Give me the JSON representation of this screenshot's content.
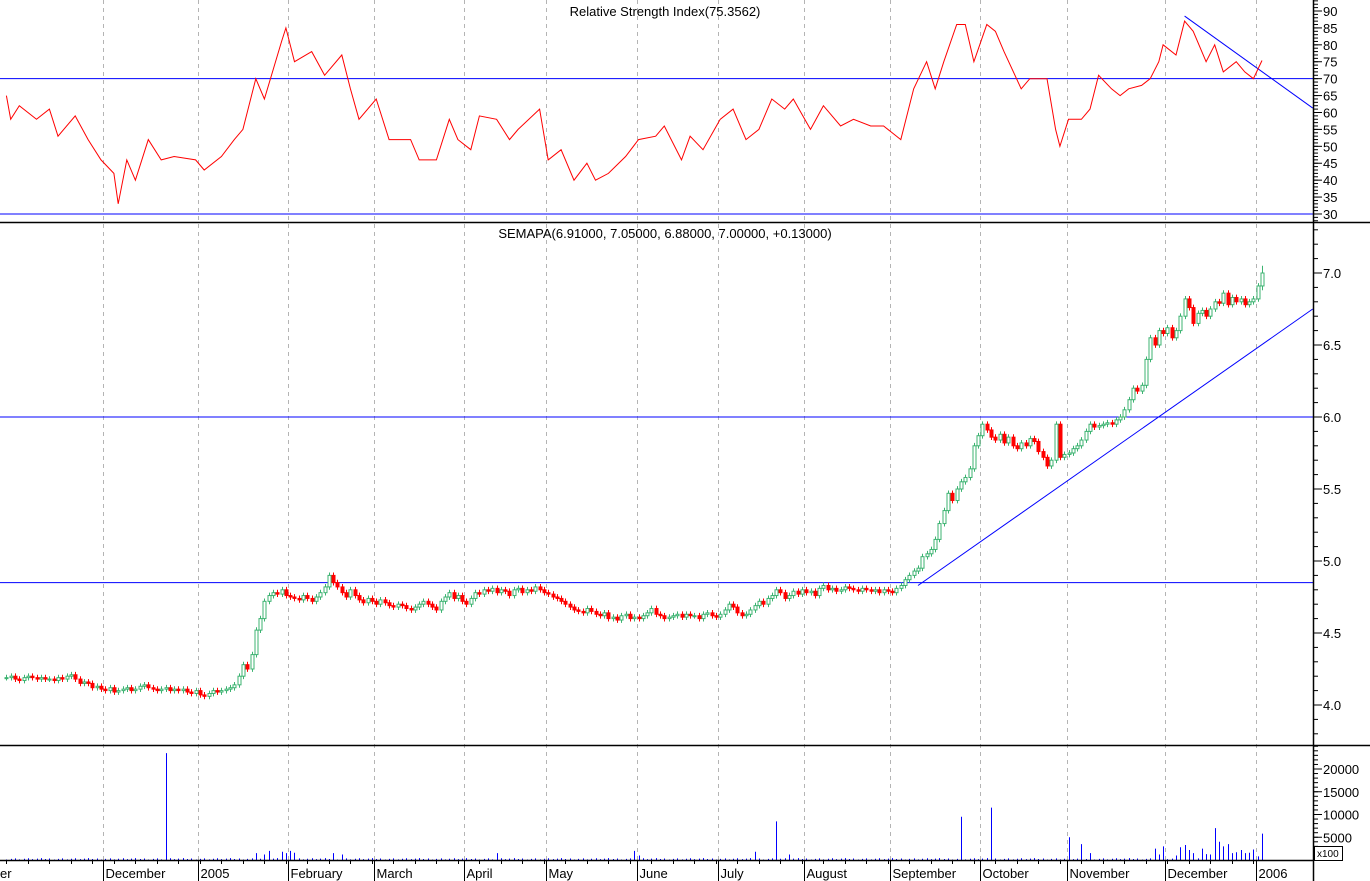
{
  "chart_data": [
    {
      "type": "line",
      "title": "Relative Strength Index(75.3562)",
      "indicator": "RSI",
      "ylim": [
        27.6,
        93.2
      ],
      "yticks": [
        30,
        35,
        40,
        45,
        50,
        55,
        60,
        65,
        70,
        75,
        80,
        85,
        90
      ],
      "reference_lines": [
        70,
        30
      ],
      "trendline": {
        "from": {
          "bar": 274,
          "value": 88.5
        },
        "to": {
          "bar": 303.8,
          "value": 61.3
        }
      },
      "series": {
        "bars": [
          0,
          1,
          3,
          7,
          10,
          12,
          16,
          19,
          22,
          25,
          26,
          28,
          30,
          33,
          36,
          39,
          44,
          46,
          50,
          53,
          55,
          58,
          60,
          64,
          65,
          67,
          71,
          74,
          78,
          80,
          82,
          86,
          89,
          94,
          96,
          100,
          103,
          105,
          108,
          110,
          114,
          117,
          119,
          124,
          126,
          129,
          132,
          135,
          137,
          140,
          144,
          147,
          151,
          153,
          157,
          159,
          162,
          166,
          169,
          172,
          175,
          178,
          181,
          183,
          187,
          190,
          194,
          197,
          201,
          204,
          208,
          211,
          214,
          216,
          218,
          221,
          223,
          225,
          228,
          230,
          232,
          236,
          238,
          242,
          244,
          245,
          247,
          250,
          252,
          254,
          257,
          259,
          261,
          264,
          266,
          268,
          269,
          272,
          274,
          276,
          279,
          281,
          283,
          286,
          288,
          290,
          292
        ],
        "values": [
          65,
          58,
          62,
          58,
          61,
          53,
          59,
          52,
          46,
          42,
          33,
          46,
          40,
          52,
          46,
          47,
          46,
          43,
          47,
          52,
          55,
          70,
          64,
          81,
          85,
          75,
          78,
          71,
          77,
          67,
          58,
          64,
          52,
          52,
          46,
          46,
          58,
          52,
          49,
          59,
          58,
          52,
          55,
          61,
          46,
          49,
          40,
          45,
          40,
          42,
          47,
          52,
          53,
          56,
          46,
          53,
          49,
          58,
          61,
          52,
          55,
          64,
          61,
          64,
          55,
          62,
          56,
          58,
          56,
          56,
          52,
          67,
          75,
          67,
          75,
          86,
          86,
          75,
          86,
          84,
          78,
          67,
          70,
          70,
          55,
          50,
          58,
          58,
          61,
          71,
          67,
          65,
          67,
          68,
          70,
          75,
          80,
          77,
          87,
          84,
          75,
          80,
          72,
          75,
          72,
          70,
          75.36
        ]
      }
    },
    {
      "type": "candlestick",
      "title": "SEMAPA(6.91000, 7.05000, 6.88000, 7.00000, +0.13000)",
      "ylim": [
        3.73,
        7.35
      ],
      "yticks": [
        "4.0",
        "4.5",
        "5.0",
        "5.5",
        "6.0",
        "6.5",
        "7.0"
      ],
      "colors": {
        "up": "#3cb371",
        "down": "#ff0000",
        "lines": "#0000ff"
      },
      "reference_lines": [
        6.0,
        4.85
      ],
      "trendline": {
        "from": {
          "bar": 212,
          "value": 4.83
        },
        "to": {
          "bar": 303.8,
          "value": 6.75
        }
      },
      "last_bar": {
        "open": 6.91,
        "high": 7.05,
        "low": 6.88,
        "close": 7.0,
        "change": 0.13
      },
      "close": [
        4.19,
        4.2,
        4.18,
        4.17,
        4.19,
        4.2,
        4.19,
        4.18,
        4.19,
        4.18,
        4.18,
        4.17,
        4.19,
        4.18,
        4.2,
        4.21,
        4.18,
        4.15,
        4.16,
        4.15,
        4.12,
        4.13,
        4.11,
        4.1,
        4.12,
        4.09,
        4.1,
        4.11,
        4.12,
        4.1,
        4.11,
        4.13,
        4.14,
        4.12,
        4.11,
        4.1,
        4.11,
        4.12,
        4.1,
        4.11,
        4.1,
        4.11,
        4.09,
        4.08,
        4.1,
        4.07,
        4.06,
        4.08,
        4.1,
        4.09,
        4.1,
        4.11,
        4.12,
        4.14,
        4.2,
        4.28,
        4.25,
        4.35,
        4.52,
        4.6,
        4.72,
        4.76,
        4.78,
        4.77,
        4.8,
        4.76,
        4.75,
        4.74,
        4.73,
        4.76,
        4.74,
        4.72,
        4.75,
        4.78,
        4.82,
        4.9,
        4.85,
        4.82,
        4.78,
        4.75,
        4.8,
        4.76,
        4.73,
        4.71,
        4.74,
        4.72,
        4.7,
        4.73,
        4.71,
        4.69,
        4.68,
        4.7,
        4.69,
        4.67,
        4.66,
        4.68,
        4.7,
        4.72,
        4.7,
        4.68,
        4.66,
        4.72,
        4.75,
        4.78,
        4.74,
        4.76,
        4.72,
        4.7,
        4.74,
        4.78,
        4.77,
        4.8,
        4.79,
        4.81,
        4.78,
        4.8,
        4.79,
        4.76,
        4.8,
        4.81,
        4.78,
        4.8,
        4.79,
        4.82,
        4.8,
        4.78,
        4.77,
        4.75,
        4.74,
        4.72,
        4.7,
        4.68,
        4.66,
        4.65,
        4.64,
        4.67,
        4.65,
        4.63,
        4.62,
        4.64,
        4.6,
        4.61,
        4.59,
        4.62,
        4.63,
        4.6,
        4.61,
        4.6,
        4.62,
        4.64,
        4.67,
        4.63,
        4.62,
        4.6,
        4.61,
        4.62,
        4.63,
        4.61,
        4.63,
        4.62,
        4.62,
        4.6,
        4.63,
        4.64,
        4.62,
        4.61,
        4.63,
        4.66,
        4.7,
        4.68,
        4.64,
        4.62,
        4.63,
        4.66,
        4.69,
        4.72,
        4.7,
        4.74,
        4.76,
        4.8,
        4.78,
        4.74,
        4.76,
        4.79,
        4.77,
        4.8,
        4.78,
        4.79,
        4.76,
        4.81,
        4.83,
        4.8,
        4.81,
        4.79,
        4.8,
        4.82,
        4.81,
        4.8,
        4.79,
        4.81,
        4.8,
        4.79,
        4.8,
        4.78,
        4.8,
        4.79,
        4.78,
        4.81,
        4.83,
        4.87,
        4.9,
        4.93,
        4.95,
        5.03,
        5.05,
        5.08,
        5.15,
        5.26,
        5.35,
        5.47,
        5.42,
        5.5,
        5.55,
        5.58,
        5.64,
        5.8,
        5.87,
        5.95,
        5.91,
        5.86,
        5.84,
        5.88,
        5.82,
        5.86,
        5.8,
        5.78,
        5.82,
        5.8,
        5.85,
        5.83,
        5.76,
        5.72,
        5.66,
        5.7,
        5.95,
        5.72,
        5.74,
        5.75,
        5.78,
        5.8,
        5.84,
        5.9,
        5.95,
        5.93,
        5.94,
        5.95,
        5.96,
        5.95,
        5.98,
        6.0,
        6.05,
        6.12,
        6.2,
        6.18,
        6.22,
        6.4,
        6.55,
        6.5,
        6.6,
        6.58,
        6.62,
        6.55,
        6.6,
        6.7,
        6.82,
        6.76,
        6.65,
        6.72,
        6.74,
        6.7,
        6.75,
        6.8,
        6.79,
        6.86,
        6.78,
        6.83,
        6.8,
        6.82,
        6.78,
        6.8,
        6.82,
        6.91,
        7.0
      ]
    },
    {
      "type": "bar",
      "title": "Volume",
      "unit_label": "x100",
      "ylim": [
        0,
        25270
      ],
      "yticks": [
        "5000",
        "10000",
        "15000",
        "20000"
      ],
      "default_value": 300,
      "bars": [
        37,
        58,
        60,
        61,
        64,
        65,
        66,
        67,
        76,
        78,
        114,
        146,
        147,
        174,
        179,
        182,
        222,
        229,
        247,
        250,
        252,
        267,
        268,
        269,
        272,
        273,
        274,
        275,
        276,
        278,
        279,
        280,
        281,
        282,
        283,
        284,
        285,
        286,
        287,
        288,
        289,
        290,
        291,
        292
      ],
      "values": [
        23500,
        1500,
        1200,
        2000,
        1800,
        1500,
        2000,
        1600,
        1500,
        1200,
        1500,
        2000,
        1000,
        1800,
        8500,
        1200,
        9500,
        11500,
        5000,
        3500,
        1500,
        2500,
        1200,
        3000,
        1000,
        2800,
        3300,
        2200,
        1500,
        2500,
        1300,
        1200,
        7000,
        4000,
        3000,
        3500,
        1500,
        1700,
        2200,
        1500,
        1600,
        2300,
        800,
        5800
      ]
    }
  ],
  "x_axis": {
    "ticks": [
      {
        "label": "er",
        "bar": -1.5
      },
      {
        "label": "December",
        "bar": 23
      },
      {
        "label": "2005",
        "bar": 45
      },
      {
        "label": "February",
        "bar": 66
      },
      {
        "label": "March",
        "bar": 86
      },
      {
        "label": "April",
        "bar": 107
      },
      {
        "label": "May",
        "bar": 126
      },
      {
        "label": "June",
        "bar": 147
      },
      {
        "label": "July",
        "bar": 166
      },
      {
        "label": "August",
        "bar": 186
      },
      {
        "label": "September",
        "bar": 206
      },
      {
        "label": "October",
        "bar": 227
      },
      {
        "label": "November",
        "bar": 247
      },
      {
        "label": "December",
        "bar": 270
      },
      {
        "label": "2006",
        "bar": 291
      }
    ]
  }
}
